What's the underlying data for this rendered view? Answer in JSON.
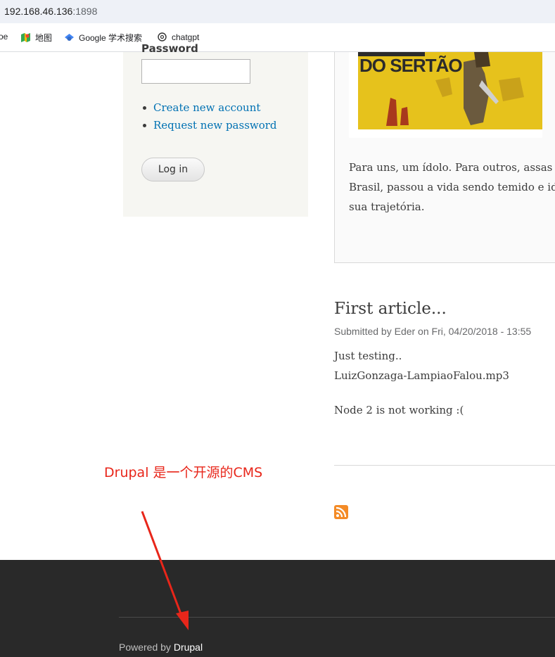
{
  "browser": {
    "url_host": "192.168.46.136",
    "url_port": ":1898",
    "bookmarks": [
      {
        "label": "oe",
        "icon": "bookmark-icon"
      },
      {
        "label": "地图",
        "icon": "maps-icon"
      },
      {
        "label": "Google 学术搜索",
        "icon": "scholar-icon"
      },
      {
        "label": "chatgpt",
        "icon": "openai-icon"
      }
    ]
  },
  "login": {
    "password_label": "Password",
    "links": [
      "Create new account",
      "Request new password"
    ],
    "login_button": "Log in"
  },
  "article1": {
    "image_text": "DO SERTÃO",
    "teaser_lines": [
      "Para uns, um ídolo. Para outros, assas",
      "Brasil, passou a vida sendo temido e id",
      "sua trajetória."
    ]
  },
  "article2": {
    "title": "First article...",
    "meta": "Submitted by Eder on Fri, 04/20/2018 - 13:55",
    "body_lines": [
      "Just testing..",
      "LuizGonzaga-LampiaoFalou.mp3"
    ],
    "body_note": "Node 2 is not working :("
  },
  "annotation": {
    "text": "Drupal 是一个开源的CMS",
    "color": "#e8261a"
  },
  "footer": {
    "powered_prefix": "Powered by ",
    "powered_link": "Drupal"
  },
  "colors": {
    "link": "#0071b3",
    "footer_bg": "#292929",
    "feed": "#f48b26"
  }
}
